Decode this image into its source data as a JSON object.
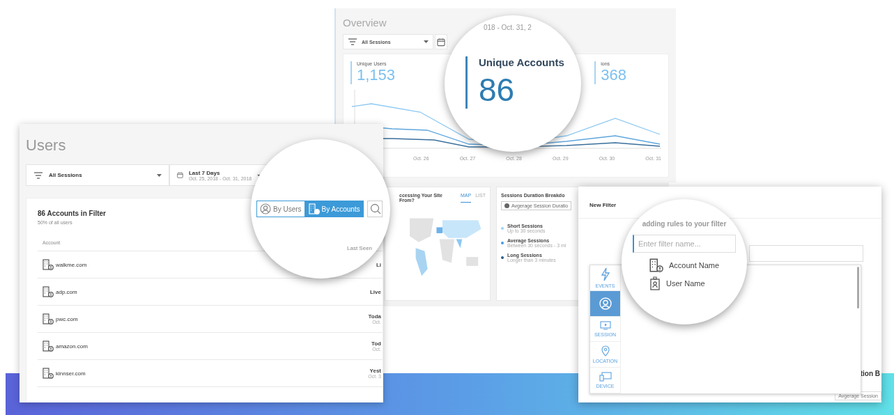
{
  "overview": {
    "title": "Overview",
    "filter": "All Sessions",
    "date_range": "018 - Oct. 31, 2",
    "metrics": [
      {
        "label": "Unique Users",
        "value": "1,153"
      },
      {
        "label": "ions",
        "value": "368"
      }
    ],
    "magnified_metric": {
      "label": "Unique Accounts",
      "value": "86"
    },
    "x_labels": [
      "Oct. 26",
      "Oct. 27",
      "Oct. 28",
      "Oct. 29",
      "Oct. 30",
      "Oct. 31"
    ]
  },
  "users": {
    "title": "Users",
    "filter": "All Sessions",
    "date": {
      "label": "Last 7 Days",
      "range": "Oct. 25, 2018 - Oct. 31, 2018"
    },
    "heading": "86 Accounts in Filter",
    "subheading": "50% of all users",
    "toggle": [
      {
        "label": "By Users",
        "selected": false
      },
      {
        "label": "By Accounts",
        "selected": true
      }
    ],
    "columns": [
      "Account",
      "Last Seen"
    ],
    "rows": [
      {
        "account": "walkme.com",
        "last_seen": "Li"
      },
      {
        "account": "adp.com",
        "last_seen": "Live"
      },
      {
        "account": "pwc.com",
        "last_seen": "Toda",
        "detail": "Oct."
      },
      {
        "account": "amazon.com",
        "last_seen": "Tod",
        "detail": "Oct."
      },
      {
        "account": "kinnser.com",
        "last_seen": "Yest",
        "detail": "Oct. 3"
      }
    ]
  },
  "map_card": {
    "title": "ccessing Your Site From?",
    "tabs": [
      {
        "label": "MAP",
        "selected": true
      },
      {
        "label": "LIST",
        "selected": false
      }
    ]
  },
  "sessions_card": {
    "title": "Sessions Duration Breakdo",
    "dropdown": "Avgerage Session Duratio",
    "legend": [
      {
        "label": "Short Sessions",
        "detail": "Up to 30 seconds",
        "color": "#9fd3f5"
      },
      {
        "label": "Average Sessions",
        "detail": "Between 30 seconds - 3 mi",
        "color": "#4a9be0"
      },
      {
        "label": "Long Sessions",
        "detail": "Longer than 3 minutes",
        "color": "#2c5d8a"
      }
    ]
  },
  "new_filter": {
    "title": "New Filter",
    "hint": "adding rules to your filter",
    "placeholder": "Enter filter name...",
    "categories": [
      {
        "kind": "events",
        "label": "EVENTS",
        "selected": false
      },
      {
        "kind": "user",
        "selected": true
      },
      {
        "kind": "session",
        "label": "SESSION",
        "selected": false
      },
      {
        "kind": "location",
        "label": "LOCATION",
        "selected": false
      },
      {
        "kind": "device",
        "label": "DEVICE",
        "selected": false
      }
    ],
    "items": [
      {
        "kind": "account",
        "label": "Account Name"
      },
      {
        "kind": "user",
        "label": "User Name"
      }
    ],
    "behind_title": "tion B",
    "behind_dropdown": "Avgerage Session"
  }
}
